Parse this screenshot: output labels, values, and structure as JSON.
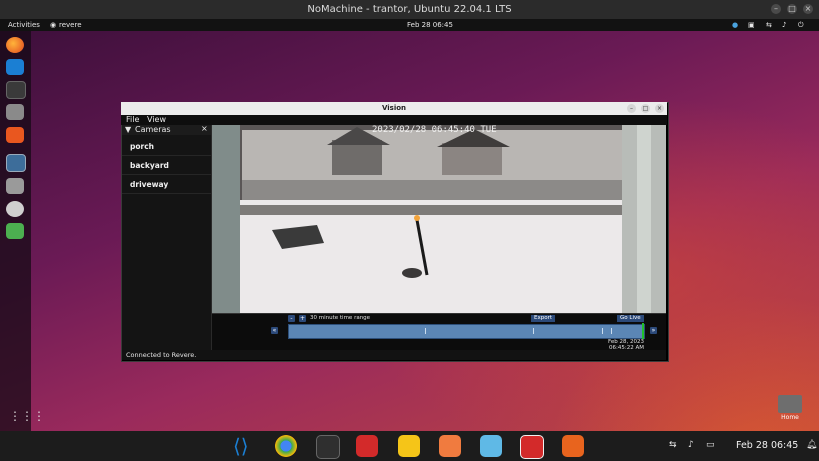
{
  "nomachine": {
    "title": "NoMachine - trantor, Ubuntu 22.04.1 LTS"
  },
  "gnome": {
    "activities": "Activities",
    "app_name": "revere",
    "clock": "Feb 28  06:45"
  },
  "vision": {
    "window_title": "Vision",
    "menu": {
      "file": "File",
      "view": "View"
    },
    "cameras_header": "Cameras",
    "cameras": [
      {
        "label": "porch"
      },
      {
        "label": "backyard"
      },
      {
        "label": "driveway"
      }
    ],
    "video_timestamp": "2023/02/28 06:45:40 TUE",
    "timeline": {
      "zoom_out": "-",
      "zoom_in": "+",
      "range_label": "30 minute time range",
      "export_label": "Export",
      "go_live_label": "Go Live",
      "date_label": "Feb 28, 2023",
      "time_label": "06:45:22 AM"
    },
    "status": "Connected to Revere."
  },
  "desktop": {
    "home_label": "Home"
  },
  "bottom_bar": {
    "clock": "Feb 28  06:45"
  },
  "colors": {
    "timeline_track": "#5b86b5",
    "live_marker": "#22c02a",
    "button_blue": "#2c4a7a"
  }
}
